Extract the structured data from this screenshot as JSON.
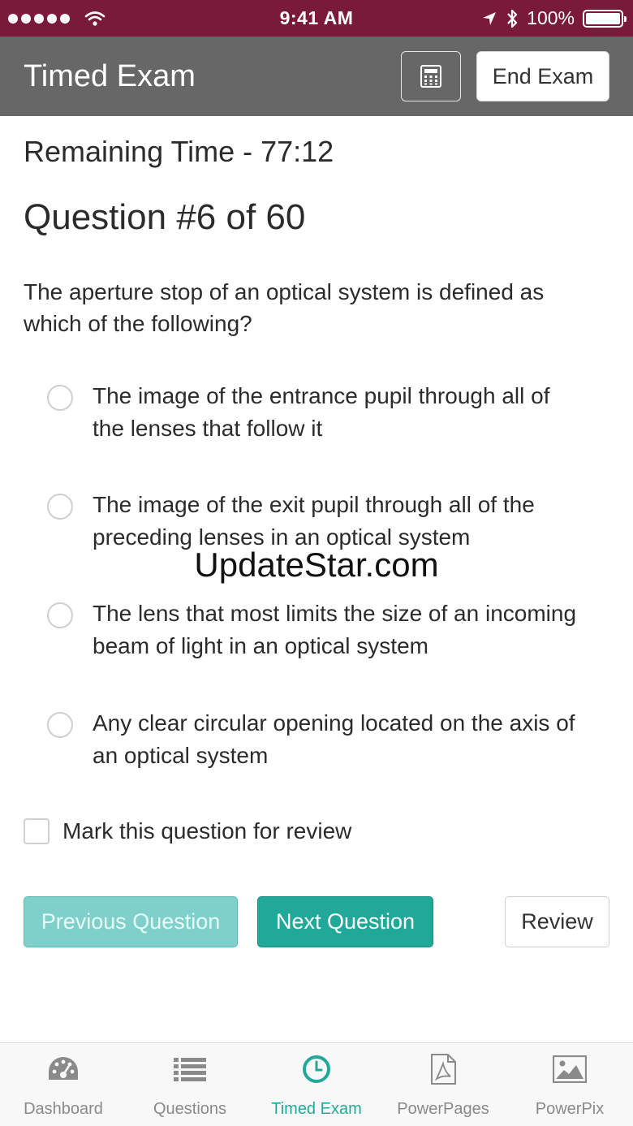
{
  "status_bar": {
    "time": "9:41 AM",
    "battery_percent": "100%"
  },
  "header": {
    "title": "Timed Exam",
    "end_exam_label": "End Exam"
  },
  "exam": {
    "remaining_time": "Remaining Time - 77:12",
    "question_number": "Question #6 of 60",
    "question_text": "The aperture stop of an optical system is defined as which of the following?",
    "options": [
      {
        "label": "The image of the entrance pupil through all of the lenses that follow it",
        "selected": false
      },
      {
        "label": "The image of the exit pupil through all of the preceding lenses in an optical system",
        "selected": false
      },
      {
        "label": "The lens that most limits the size of an incoming beam of light in an optical system",
        "selected": false
      },
      {
        "label": "Any clear circular opening located on the axis of an optical system",
        "selected": false
      }
    ],
    "mark_review_label": "Mark this question for review",
    "mark_review_checked": false
  },
  "buttons": {
    "previous": "Previous Question",
    "next": "Next Question",
    "review": "Review"
  },
  "watermark": "UpdateStar.com",
  "tabs": [
    {
      "label": "Dashboard",
      "icon": "dashboard-icon",
      "active": false
    },
    {
      "label": "Questions",
      "icon": "list-icon",
      "active": false
    },
    {
      "label": "Timed Exam",
      "icon": "clock-icon",
      "active": true
    },
    {
      "label": "PowerPages",
      "icon": "pdf-icon",
      "active": false
    },
    {
      "label": "PowerPix",
      "icon": "image-icon",
      "active": false
    }
  ],
  "colors": {
    "status_bar": "#7a1a3a",
    "header": "#676767",
    "accent": "#22a899",
    "accent_light": "#7fd0cb"
  }
}
